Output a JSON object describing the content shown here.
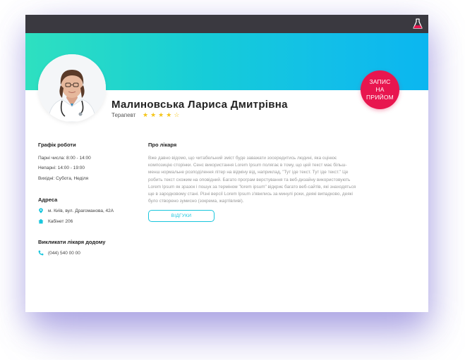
{
  "colors": {
    "topbar": "#3a3940",
    "gradient_start": "#2ee0c0",
    "gradient_end": "#0bb6f0",
    "accent_red": "#e8164f",
    "accent_cyan": "#19c6dd",
    "star": "#f5c518"
  },
  "header": {
    "logo_icon": "flask-logo-icon"
  },
  "doctor": {
    "name": "Малиновська Лариса Дмитрівна",
    "specialty": "Терапевт",
    "rating": 4,
    "rating_max": 5,
    "appointment_label": "Запис на прийом"
  },
  "schedule": {
    "title": "Графік роботи",
    "odd_days": "Парні числа: 8:00 - 14:00",
    "even_days": "Непарні: 14:00 - 19:00",
    "days_off": "Вихідні: Субота, Неділя"
  },
  "address": {
    "title": "Адреса",
    "street": "м. Київ, вул. Драгоманова, 42А",
    "street_icon": "map-pin-icon",
    "office": "Кабінет 206",
    "office_icon": "home-icon"
  },
  "home_call": {
    "title": "Викликати лікаря додому",
    "phone": "(044) 540 00 00",
    "phone_icon": "phone-icon"
  },
  "about": {
    "title": "Про лікаря",
    "text": "Вже давно відомо, що читабельний зміст буде заважати зосередитись людині, яка оцінює композицію сторінки. Сенс використання Lorem Ipsum полягає в тому, що цей текст має більш-менш нормальне розподілення літер на відміну від, наприклад, \"Тут іде текст. Тут іде текст.\" Це робить текст схожим на оповідний. Багато програм верстування та веб-дизайну використовують Lorem Ipsum як зразок і пошук за терміном \"lorem ipsum\" відкриє багато веб-сайтів, які знаходяться ще в зародковому стані. Різні версії Lorem Ipsum з'явились за минулі роки, деякі випадково, деякі було створено зумисно (зокрема, жартівливі).",
    "reviews_label": "Відгуки"
  }
}
